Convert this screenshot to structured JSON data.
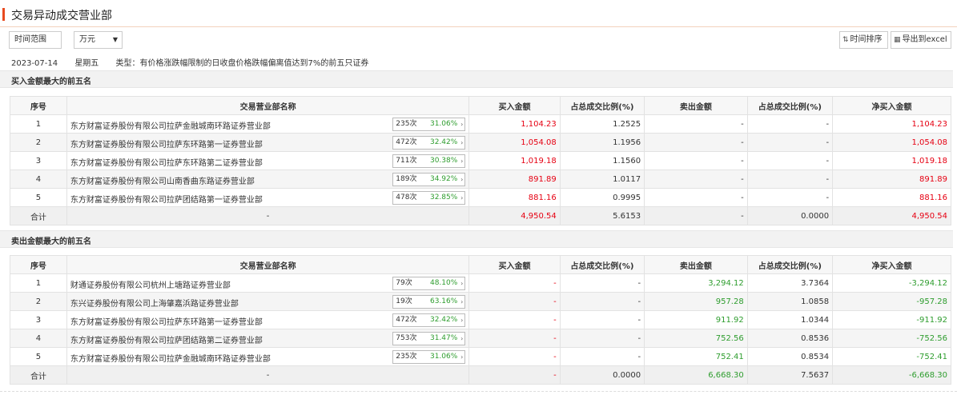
{
  "title": "交易异动成交营业部",
  "toolbar": {
    "range_label": "时间范围",
    "unit_value": "万元",
    "sort_label": "时间排序",
    "export_label": "导出到excel"
  },
  "info": {
    "date": "2023-07-14",
    "weekday": "星期五",
    "type": "类型：有价格涨跌幅限制的日收盘价格跌幅偏离值达到7%的前五只证券"
  },
  "headers": [
    "序号",
    "交易营业部名称",
    "买入金额",
    "占总成交比例(%)",
    "卖出金额",
    "占总成交比例(%)",
    "净买入金额"
  ],
  "buy": {
    "section_label": "买入金额最大的前五名",
    "rows": [
      {
        "no": "1",
        "name": "东方财富证券股份有限公司拉萨金融城南环路证券营业部",
        "count": "235次",
        "pct": "31.06%",
        "buy": "1,104.23",
        "buy_pct": "1.2525",
        "sell": "-",
        "sell_pct": "-",
        "net": "1,104.23"
      },
      {
        "no": "2",
        "name": "东方财富证券股份有限公司拉萨东环路第一证券营业部",
        "count": "472次",
        "pct": "32.42%",
        "buy": "1,054.08",
        "buy_pct": "1.1956",
        "sell": "-",
        "sell_pct": "-",
        "net": "1,054.08"
      },
      {
        "no": "3",
        "name": "东方财富证券股份有限公司拉萨东环路第二证券营业部",
        "count": "711次",
        "pct": "30.38%",
        "buy": "1,019.18",
        "buy_pct": "1.1560",
        "sell": "-",
        "sell_pct": "-",
        "net": "1,019.18"
      },
      {
        "no": "4",
        "name": "东方财富证券股份有限公司山南香曲东路证券营业部",
        "count": "189次",
        "pct": "34.92%",
        "buy": "891.89",
        "buy_pct": "1.0117",
        "sell": "-",
        "sell_pct": "-",
        "net": "891.89"
      },
      {
        "no": "5",
        "name": "东方财富证券股份有限公司拉萨团结路第一证券营业部",
        "count": "478次",
        "pct": "32.85%",
        "buy": "881.16",
        "buy_pct": "0.9995",
        "sell": "-",
        "sell_pct": "-",
        "net": "881.16"
      }
    ],
    "total": {
      "label": "合计",
      "name": "-",
      "buy": "4,950.54",
      "buy_pct": "5.6153",
      "sell": "-",
      "sell_pct": "0.0000",
      "net": "4,950.54"
    }
  },
  "sell": {
    "section_label": "卖出金额最大的前五名",
    "rows": [
      {
        "no": "1",
        "name": "财通证券股份有限公司杭州上塘路证券营业部",
        "count": "79次",
        "pct": "48.10%",
        "buy": "-",
        "buy_pct": "-",
        "sell": "3,294.12",
        "sell_pct": "3.7364",
        "net": "-3,294.12"
      },
      {
        "no": "2",
        "name": "东兴证券股份有限公司上海肇嘉浜路证券营业部",
        "count": "19次",
        "pct": "63.16%",
        "buy": "-",
        "buy_pct": "-",
        "sell": "957.28",
        "sell_pct": "1.0858",
        "net": "-957.28"
      },
      {
        "no": "3",
        "name": "东方财富证券股份有限公司拉萨东环路第一证券营业部",
        "count": "472次",
        "pct": "32.42%",
        "buy": "-",
        "buy_pct": "-",
        "sell": "911.92",
        "sell_pct": "1.0344",
        "net": "-911.92"
      },
      {
        "no": "4",
        "name": "东方财富证券股份有限公司拉萨团结路第二证券营业部",
        "count": "753次",
        "pct": "31.47%",
        "buy": "-",
        "buy_pct": "-",
        "sell": "752.56",
        "sell_pct": "0.8536",
        "net": "-752.56"
      },
      {
        "no": "5",
        "name": "东方财富证券股份有限公司拉萨金融城南环路证券营业部",
        "count": "235次",
        "pct": "31.06%",
        "buy": "-",
        "buy_pct": "-",
        "sell": "752.41",
        "sell_pct": "0.8534",
        "net": "-752.41"
      }
    ],
    "total": {
      "label": "合计",
      "name": "-",
      "buy": "-",
      "buy_pct": "0.0000",
      "sell": "6,668.30",
      "sell_pct": "7.5637",
      "net": "-6,668.30"
    }
  }
}
